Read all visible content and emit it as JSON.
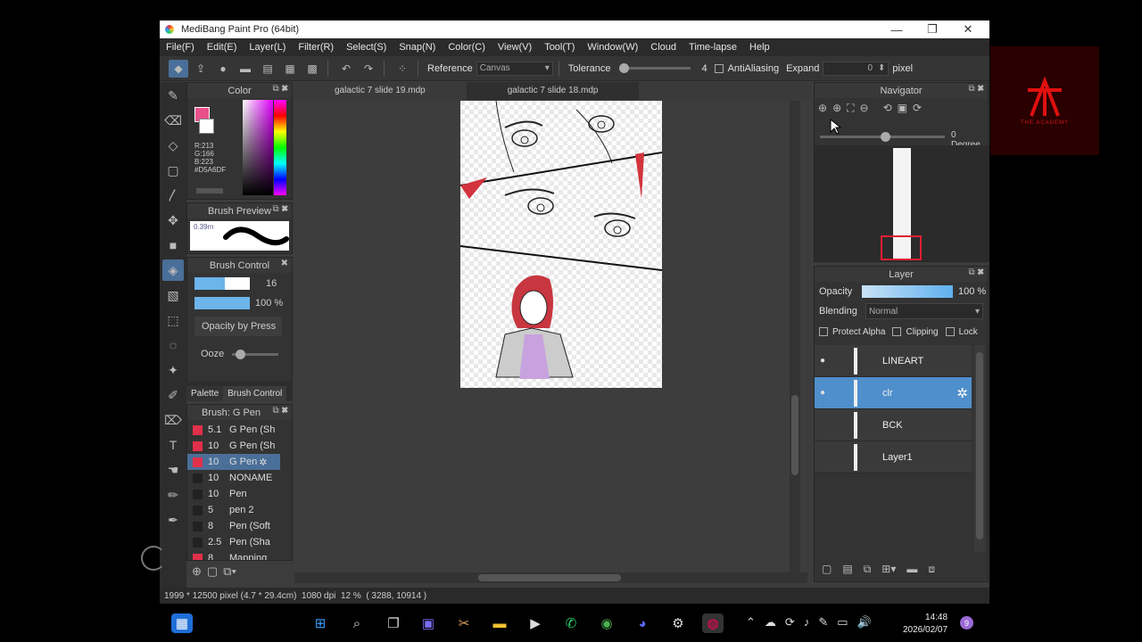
{
  "window": {
    "title": "MediBang Paint Pro (64bit)"
  },
  "menu": [
    "File(F)",
    "Edit(E)",
    "Layer(L)",
    "Filter(R)",
    "Select(S)",
    "Snap(N)",
    "Color(C)",
    "View(V)",
    "Tool(T)",
    "Window(W)",
    "Cloud",
    "Time-lapse",
    "Help"
  ],
  "toolbar": {
    "reference_label": "Reference",
    "reference_value": "Canvas",
    "tolerance_label": "Tolerance",
    "tolerance_value": "4",
    "antialias_label": "AntiAliasing",
    "expand_label": "Expand",
    "expand_value": "0",
    "expand_unit": "pixel"
  },
  "tabs": [
    "galactic 7 slide 19.mdp",
    "galactic 7 slide 18.mdp"
  ],
  "color_panel": {
    "title": "Color",
    "r": "R:213",
    "g": "G:166",
    "b": "B:223",
    "hex": "#D5A6DF",
    "fg": "#e8508a",
    "bg": "#ffffff"
  },
  "brush_preview": {
    "title": "Brush Preview",
    "size": "0.39m"
  },
  "brush_control": {
    "title": "Brush Control",
    "size": "16",
    "opacity": "100 %",
    "opacity_by_pressure": "Opacity by Press",
    "ooze": "Ooze",
    "size_level": 0.55,
    "opacity_level": 1.0
  },
  "palette_tabs": [
    "Palette",
    "Brush Control"
  ],
  "brush_list": {
    "title": "Brush: G Pen",
    "items": [
      {
        "size": "5.1",
        "name": "G Pen (Sh",
        "color": "#e0304a",
        "selected": false
      },
      {
        "size": "10",
        "name": "G Pen (Sh",
        "color": "#e0304a",
        "selected": false
      },
      {
        "size": "10",
        "name": "G Pen",
        "color": "#e0304a",
        "selected": true
      },
      {
        "size": "10",
        "name": "NONAME",
        "color": "#222222",
        "selected": false
      },
      {
        "size": "10",
        "name": "Pen",
        "color": "#222222",
        "selected": false
      },
      {
        "size": "5",
        "name": "pen 2",
        "color": "#222222",
        "selected": false
      },
      {
        "size": "8",
        "name": "Pen (Soft",
        "color": "#222222",
        "selected": false
      },
      {
        "size": "2.5",
        "name": "Pen (Sha",
        "color": "#222222",
        "selected": false
      },
      {
        "size": "8",
        "name": "Mapping",
        "color": "#e0304a",
        "selected": false
      }
    ]
  },
  "navigator": {
    "title": "Navigator",
    "degree": "0 Degree"
  },
  "layer_panel": {
    "title": "Layer",
    "opacity_label": "Opacity",
    "opacity_value": "100 %",
    "blending_label": "Blending",
    "blending_value": "Normal",
    "protect_alpha": "Protect Alpha",
    "clipping": "Clipping",
    "lock": "Lock",
    "layers": [
      {
        "name": "LINEART",
        "selected": false,
        "visible": true
      },
      {
        "name": "clr",
        "selected": true,
        "visible": true
      },
      {
        "name": "BCK",
        "selected": false,
        "visible": false
      },
      {
        "name": "Layer1",
        "selected": false,
        "visible": false
      }
    ]
  },
  "status": {
    "dimensions": "1999 * 12500 pixel",
    "cm": "(4.7 * 29.4cm)",
    "dpi": "1080 dpi",
    "zoom": "12 %",
    "coords": "( 3288, 10914 )"
  },
  "taskbar": {
    "time": "14:48",
    "date": "2026/02/07",
    "notif_count": "9"
  },
  "logo_text": "THE ACADEMY"
}
